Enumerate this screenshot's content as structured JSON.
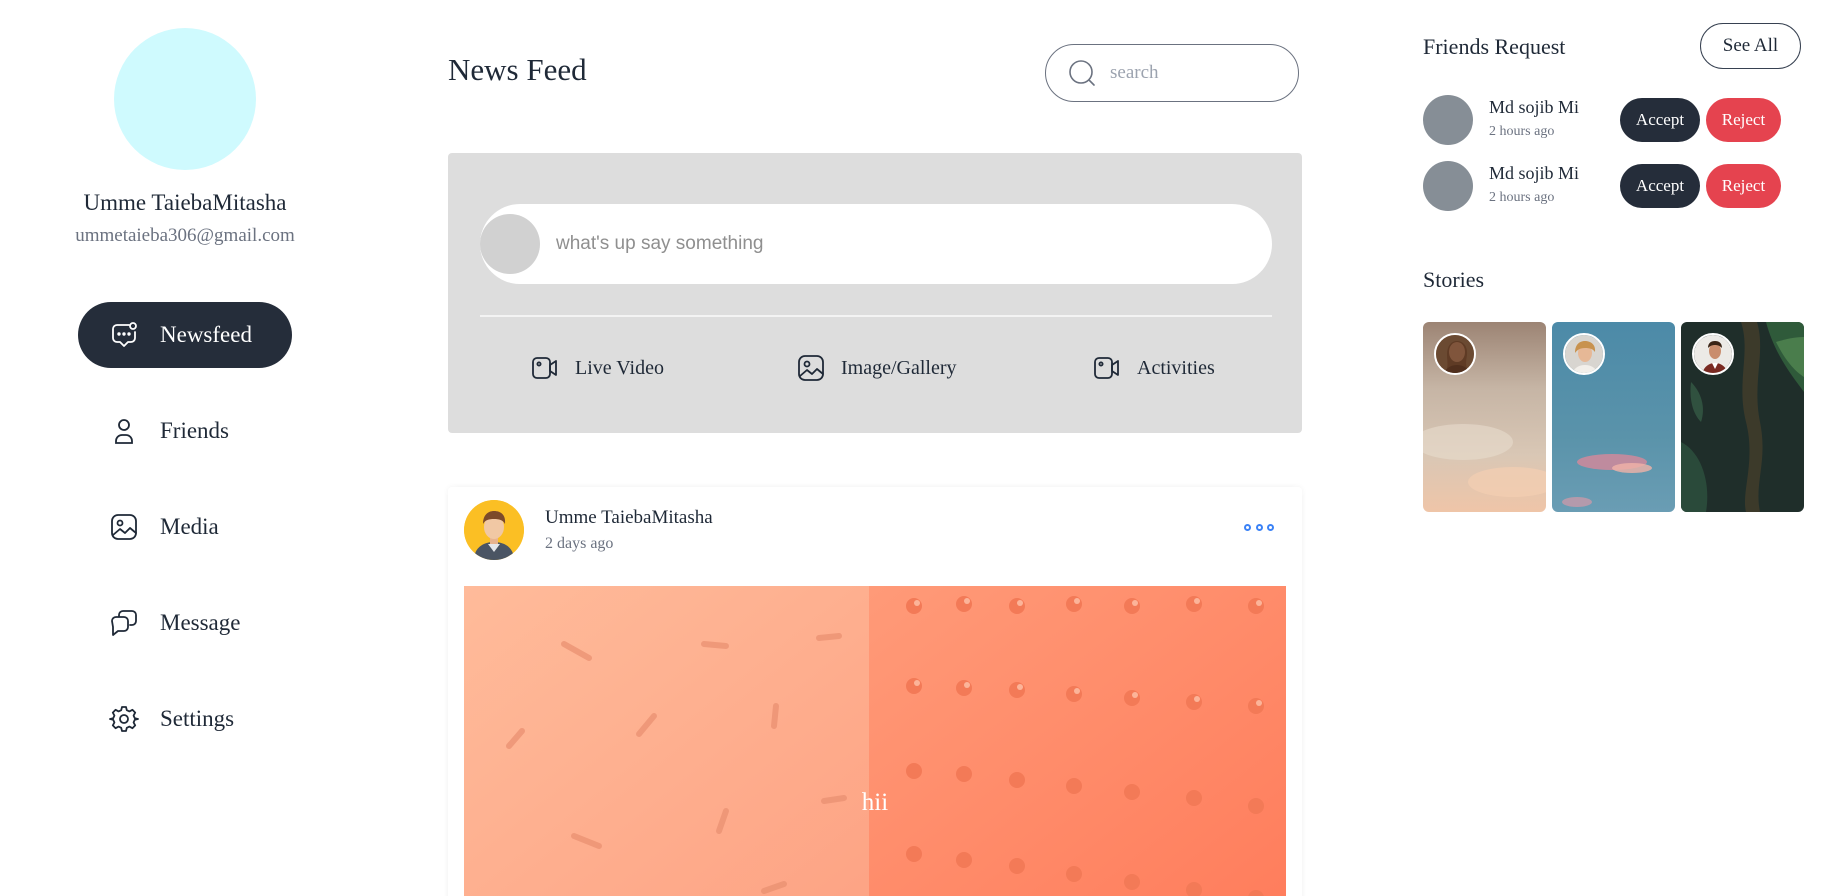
{
  "profile": {
    "name": "Umme TaiebaMitasha",
    "email": "ummetaieba306@gmail.com"
  },
  "nav": {
    "items": [
      {
        "label": "Newsfeed",
        "icon": "chat-bubble-icon",
        "active": true
      },
      {
        "label": "Friends",
        "icon": "user-icon",
        "active": false
      },
      {
        "label": "Media",
        "icon": "image-icon",
        "active": false
      },
      {
        "label": "Message",
        "icon": "messages-icon",
        "active": false
      },
      {
        "label": "Settings",
        "icon": "gear-icon",
        "active": false
      }
    ]
  },
  "header": {
    "title": "News Feed",
    "search_placeholder": "search"
  },
  "composer": {
    "placeholder": "what's up say something",
    "actions": [
      {
        "label": "Live Video",
        "icon": "video-camera-icon"
      },
      {
        "label": "Image/Gallery",
        "icon": "image-icon"
      },
      {
        "label": "Activities",
        "icon": "video-camera-icon"
      }
    ]
  },
  "post": {
    "author": "Umme TaiebaMitasha",
    "time": "2 days ago",
    "caption": "hii"
  },
  "friend_requests": {
    "title": "Friends Request",
    "see_all": "See All",
    "items": [
      {
        "name": "Md sojib Mi",
        "time": "2 hours ago",
        "accept": "Accept",
        "reject": "Reject"
      },
      {
        "name": "Md sojib Mi",
        "time": "2 hours ago",
        "accept": "Accept",
        "reject": "Reject"
      }
    ]
  },
  "stories": {
    "title": "Stories"
  },
  "colors": {
    "dark": "#252d3a",
    "reject": "#e5434f",
    "avatar_big": "#cffafe",
    "composer_bg": "#dddddd",
    "menu_dots": "#3b82f6"
  }
}
